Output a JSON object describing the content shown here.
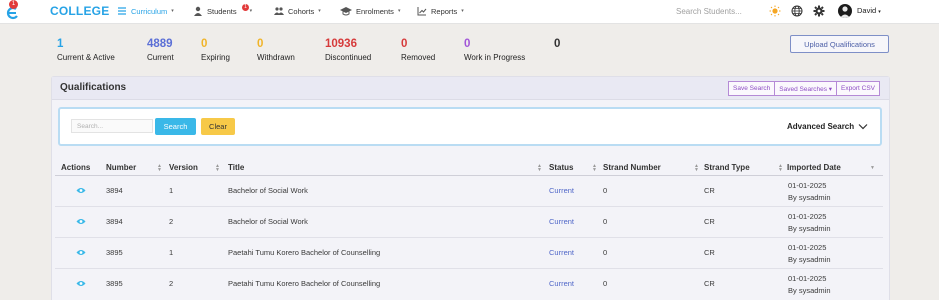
{
  "nav": {
    "logo_badge": "1",
    "brand": "COLLEGE",
    "items": [
      {
        "label": "Curriculum",
        "icon": "menu-icon",
        "active": true,
        "caret": "▾"
      },
      {
        "label": "Students",
        "icon": "person-icon",
        "badge": "1",
        "caret": "▾"
      },
      {
        "label": "Cohorts",
        "icon": "group-icon",
        "caret": "▾"
      },
      {
        "label": "Enrolments",
        "icon": "mortarboard-icon",
        "caret": "▾"
      },
      {
        "label": "Reports",
        "icon": "chart-icon",
        "caret": "▾"
      }
    ],
    "search_placeholder": "Search Students...",
    "user_name": "David",
    "user_caret": "▾"
  },
  "stats": [
    {
      "value": "1",
      "label": "Current & Active",
      "color": "#27a3e6"
    },
    {
      "value": "4889",
      "label": "Current",
      "color": "#5b6fd6"
    },
    {
      "value": "0",
      "label": "Expiring",
      "color": "#f0b429"
    },
    {
      "value": "0",
      "label": "Withdrawn",
      "color": "#f0b429"
    },
    {
      "value": "10936",
      "label": "Discontinued",
      "color": "#d63b3b"
    },
    {
      "value": "0",
      "label": "Removed",
      "color": "#d63b3b"
    },
    {
      "value": "0",
      "label": "Work in Progress",
      "color": "#a155d8"
    },
    {
      "value": "0",
      "label": "",
      "color": "#333333"
    }
  ],
  "upload_label": "Upload Qualifications",
  "panel": {
    "title": "Qualifications",
    "buttons": {
      "save_search": "Save Search",
      "saved_searches": "Saved Searches ▾",
      "export_csv": "Export CSV"
    },
    "search_placeholder": "Search...",
    "search_button": "Search",
    "clear_button": "Clear",
    "advanced_search": "Advanced Search"
  },
  "table": {
    "columns": [
      "Actions",
      "Number",
      "Version",
      "Title",
      "Status",
      "Strand Number",
      "Strand Type",
      "Imported Date"
    ],
    "rows": [
      {
        "number": "3894",
        "version": "1",
        "title": "Bachelor of Social Work",
        "status": "Current",
        "strand_number": "0",
        "strand_type": "CR",
        "date": "01-01-2025",
        "by": "By sysadmin"
      },
      {
        "number": "3894",
        "version": "2",
        "title": "Bachelor of Social Work",
        "status": "Current",
        "strand_number": "0",
        "strand_type": "CR",
        "date": "01-01-2025",
        "by": "By sysadmin"
      },
      {
        "number": "3895",
        "version": "1",
        "title": "Paetahi Tumu Korero Bachelor of Counselling",
        "status": "Current",
        "strand_number": "0",
        "strand_type": "CR",
        "date": "01-01-2025",
        "by": "By sysadmin"
      },
      {
        "number": "3895",
        "version": "2",
        "title": "Paetahi Tumu Korero Bachelor of Counselling",
        "status": "Current",
        "strand_number": "0",
        "strand_type": "CR",
        "date": "01-01-2025",
        "by": "By sysadmin"
      }
    ]
  },
  "colors": {
    "accent": "#27a3e6",
    "status_link": "#4f66c8",
    "search_btn": "#3ab8e8",
    "clear_btn": "#f7c948",
    "purple": "#8e4ec4"
  }
}
